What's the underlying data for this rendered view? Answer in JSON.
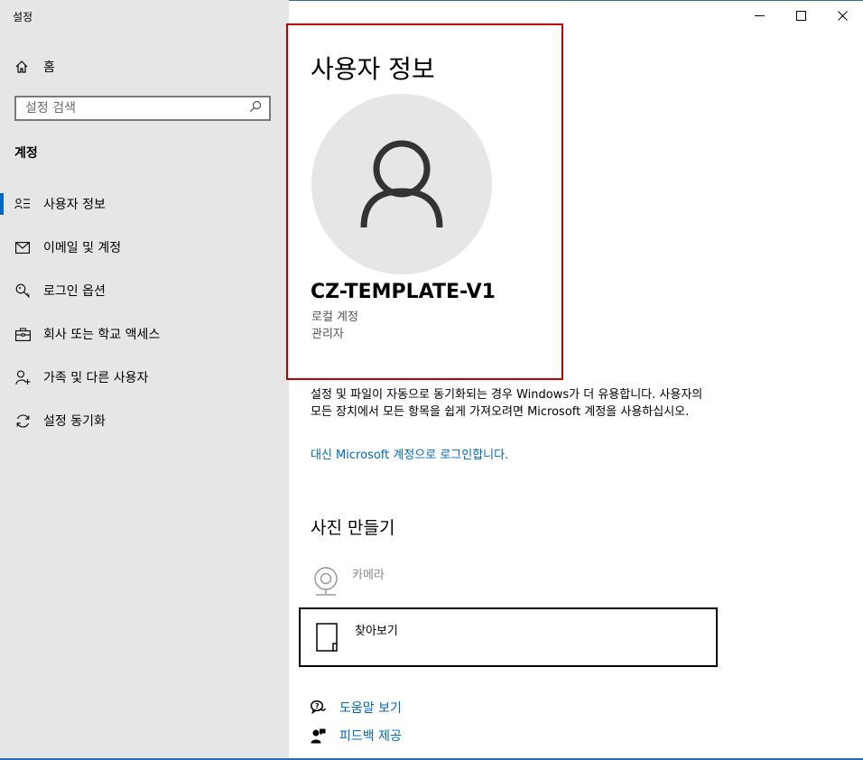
{
  "window": {
    "title": "설정",
    "minimize_glyph": "—",
    "close_glyph": "✕"
  },
  "sidebar": {
    "home_label": "홈",
    "search_placeholder": "설정 검색",
    "section_title": "계정",
    "items": [
      {
        "label": "사용자 정보",
        "icon": "person-list-icon",
        "active": true
      },
      {
        "label": "이메일 및 계정",
        "icon": "mail-icon",
        "active": false
      },
      {
        "label": "로그인 옵션",
        "icon": "key-icon",
        "active": false
      },
      {
        "label": "회사 또는 학교 액세스",
        "icon": "briefcase-icon",
        "active": false
      },
      {
        "label": "가족 및 다른 사용자",
        "icon": "add-person-icon",
        "active": false
      },
      {
        "label": "설정 동기화",
        "icon": "sync-icon",
        "active": false
      }
    ]
  },
  "main": {
    "page_title": "사용자 정보",
    "user_name": "CZ-TEMPLATE-V1",
    "account_type": "로컬 계정",
    "account_role": "관리자",
    "sync_text": "설정 및 파일이 자동으로 동기화되는 경우 Windows가 더 유용합니다. 사용자의 모든 장치에서 모든 항목을 쉽게 가져오려면 Microsoft 계정을 사용하십시오.",
    "ms_link": "대신 Microsoft 계정으로 로그인합니다.",
    "photo_title": "사진 만들기",
    "camera_label": "카메라",
    "browse_label": "찾아보기",
    "help_label": "도움말 보기",
    "feedback_label": "피드백 제공"
  },
  "colors": {
    "accent": "#0067c0",
    "highlight_border": "#c00000",
    "sidebar_bg": "#e6e6e6"
  }
}
